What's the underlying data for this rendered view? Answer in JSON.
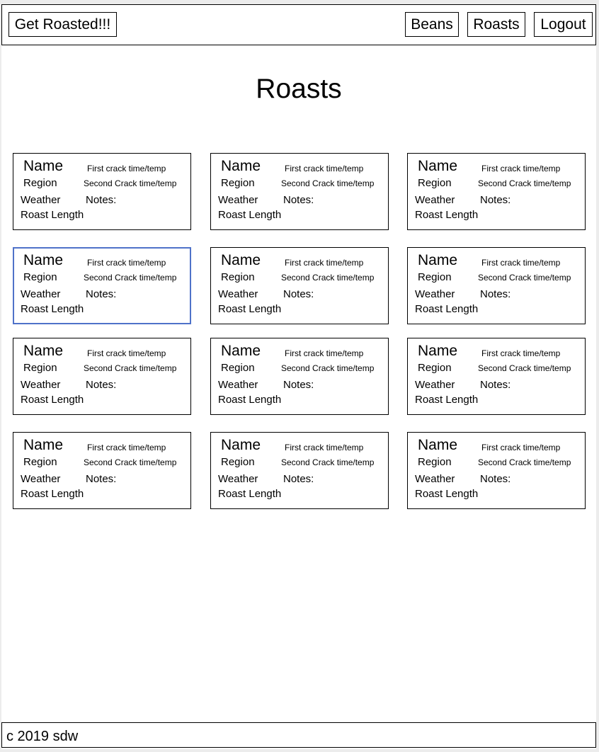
{
  "navbar": {
    "brand": "Get Roasted!!!",
    "links": [
      "Beans",
      "Roasts",
      "Logout"
    ]
  },
  "page": {
    "title": "Roasts"
  },
  "card": {
    "name": "Name",
    "first_crack": "First crack time/temp",
    "region": "Region",
    "second_crack": "Second Crack time/temp",
    "weather": "Weather",
    "notes": "Notes:",
    "roast_length": "Roast Length"
  },
  "footer": {
    "text": "c 2019 sdw"
  },
  "colors": {
    "selected_border": "#4f72c9"
  }
}
